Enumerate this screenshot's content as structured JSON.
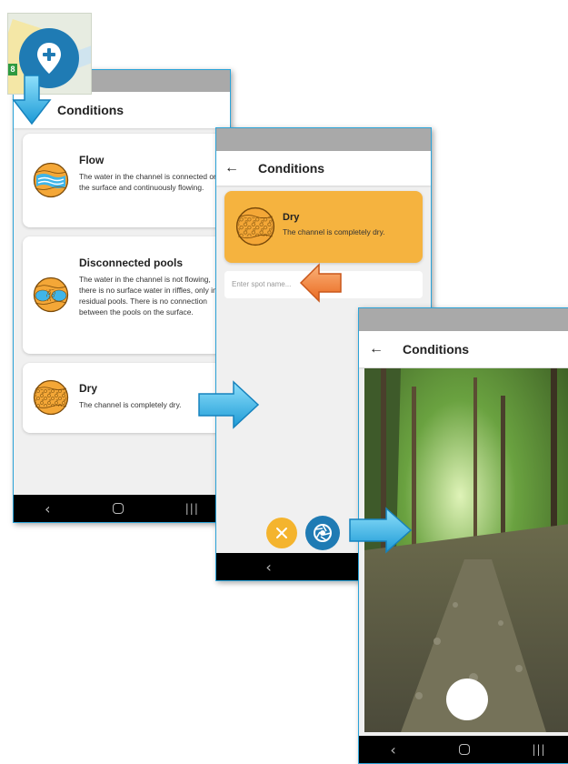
{
  "map_pin": {
    "badge": "8"
  },
  "screen1": {
    "title": "Conditions",
    "cards": [
      {
        "title": "Flow",
        "description": "The water in the channel is connected on the surface and continuously flowing."
      },
      {
        "title": "Disconnected pools",
        "description": "The water in the channel is not flowing, there is no surface water in riffles, only in residual pools. There is no connection between the pools on the surface."
      },
      {
        "title": "Dry",
        "description": "The channel is completely dry."
      }
    ]
  },
  "screen2": {
    "title": "Conditions",
    "selected": {
      "title": "Dry",
      "description": "The channel is completely dry."
    },
    "spot_placeholder": "Enter spot name..."
  },
  "screen3": {
    "title": "Conditions"
  },
  "nav": {
    "back": "‹",
    "recent": "|||"
  },
  "colors": {
    "accent_blue": "#1f7bb4",
    "selected_card": "#f5b33f",
    "cancel": "#f4b42e",
    "arrow_blue": "#29b2e8",
    "arrow_orange": "#f07f2a"
  },
  "icons": [
    "map-pin-plus-icon",
    "flow-icon",
    "pools-icon",
    "dry-icon",
    "back-arrow-icon",
    "close-icon",
    "camera-shutter-icon"
  ]
}
